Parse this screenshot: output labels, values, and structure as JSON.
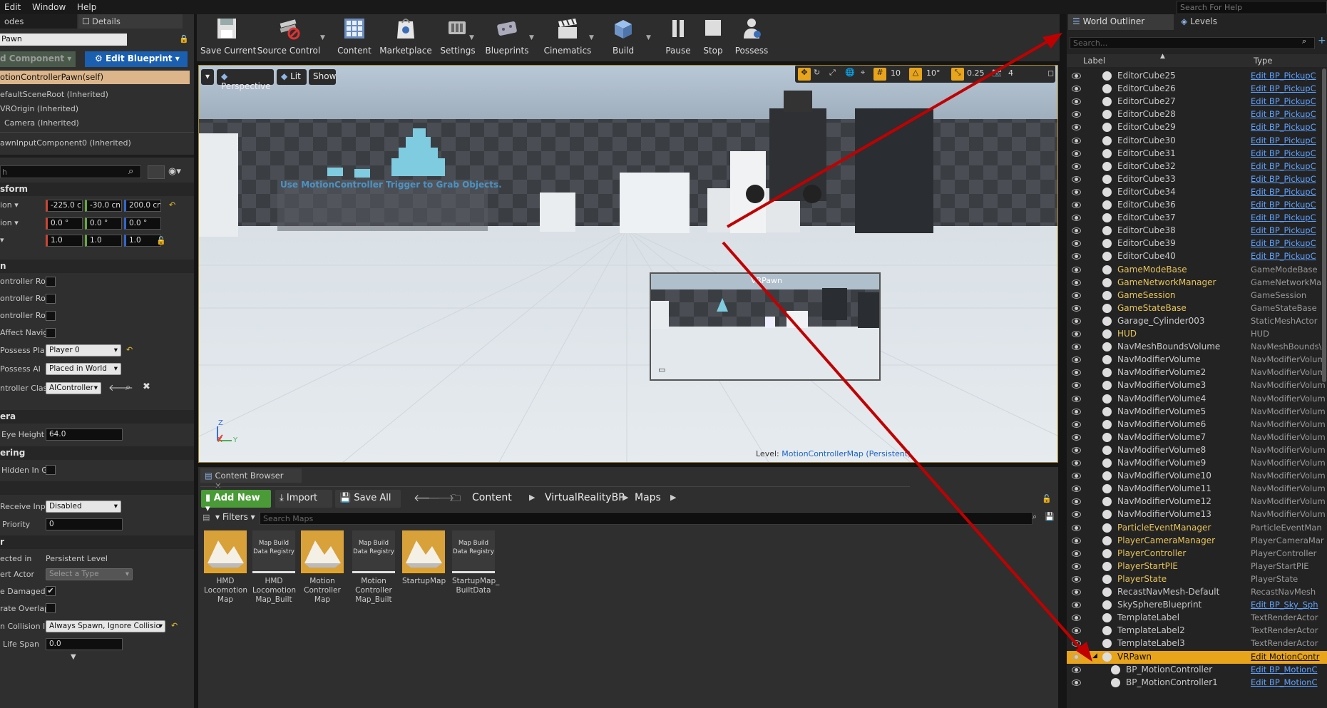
{
  "menubar": {
    "items": [
      "Edit",
      "Window",
      "Help"
    ],
    "search_placeholder": "Search For Help"
  },
  "left_panel": {
    "tabs": [
      "odes",
      "Details"
    ],
    "name_value": "Pawn",
    "add_component": "d Component",
    "edit_blueprint": "Edit Blueprint",
    "components": [
      "otionControllerPawn(self)",
      "efaultSceneRoot (Inherited)",
      "VROrigin (Inherited)",
      "Camera (Inherited)",
      "awnInputComponent0 (Inherited)"
    ],
    "search_placeholder": "h",
    "transform": {
      "title": "sform",
      "location_label": "ion",
      "location": [
        "-225.0 c",
        "-30.0 cn",
        "200.0 cn"
      ],
      "rotation_label": "ion",
      "rotation": [
        "0.0 °",
        "0.0 °",
        "0.0 °"
      ],
      "scale": [
        "1.0",
        "1.0",
        "1.0"
      ]
    },
    "pawn_section": "n",
    "pawn_props": [
      "ontroller Ro",
      "ontroller Ro",
      "ontroller Ro",
      "Affect Navig",
      "Possess Pla",
      "Possess AI",
      "ntroller Clas"
    ],
    "auto_possess_player": "Player 0",
    "auto_possess_ai": "Placed in World",
    "ai_controller_class": "AIController",
    "camera_section": "era",
    "eye_height_label": "Eye Height",
    "eye_height": "64.0",
    "rendering_section": "ering",
    "hidden_in_game": "Hidden In G",
    "input_section": "",
    "receive_input_label": "Receive Inp",
    "receive_input": "Disabled",
    "priority_label": "Priority",
    "priority": "0",
    "actor_section": "r",
    "selected_in_label": "ected in",
    "selected_in_value": "Persistent Level",
    "convert_actor_label": "ert Actor",
    "convert_actor_value": "Select a Type",
    "can_be_damaged_label": "e Damaged",
    "generate_overlap_label": "rate Overlap",
    "spawn_collision_label": "n Collision I",
    "spawn_collision_value": "Always Spawn, Ignore Collisio",
    "life_span_label": "Life Span",
    "life_span_value": "0.0"
  },
  "toolbar": {
    "buttons": [
      "Save Current",
      "Source Control",
      "Content",
      "Marketplace",
      "Settings",
      "Blueprints",
      "Cinematics",
      "Build",
      "Pause",
      "Stop",
      "Possess"
    ]
  },
  "viewport": {
    "perspective": "Perspective",
    "lit": "Lit",
    "show": "Show",
    "grid_snap": "10",
    "rot_snap": "10°",
    "scale_snap": "0.25",
    "cam_speed": "4",
    "scene_text": "Use MotionController Trigger to Grab Objects.",
    "pip_title": "VRPawn",
    "level_label": "Level:",
    "level_name": "MotionControllerMap (Persistent)",
    "axis_z": "Z",
    "axis_x": "X",
    "axis_y": "Y"
  },
  "content_browser": {
    "tab": "Content Browser",
    "add_new": "Add New",
    "import": "Import",
    "save_all": "Save All",
    "path": [
      "Content",
      "VirtualRealityBP",
      "Maps"
    ],
    "filters": "Filters",
    "search_placeholder": "Search Maps",
    "assets": [
      {
        "name": "HMD Locomotion Map",
        "kind": "map"
      },
      {
        "name": "HMD Locomotion Map_Built",
        "kind": "registry"
      },
      {
        "name": "Motion Controller Map",
        "kind": "map"
      },
      {
        "name": "Motion Controller Map_Built",
        "kind": "registry"
      },
      {
        "name": "StartupMap",
        "kind": "map"
      },
      {
        "name": "StartupMap_ BuiltData",
        "kind": "registry"
      }
    ],
    "registry_text": "Map Build Data Registry"
  },
  "outliner": {
    "tabs": [
      "World Outliner",
      "Levels"
    ],
    "search_placeholder": "Search...",
    "col_label": "Label",
    "col_type": "Type",
    "rows": [
      {
        "label": "EditorCube25",
        "type": "Edit BP_PickupC",
        "link": true
      },
      {
        "label": "EditorCube26",
        "type": "Edit BP_PickupC",
        "link": true
      },
      {
        "label": "EditorCube27",
        "type": "Edit BP_PickupC",
        "link": true
      },
      {
        "label": "EditorCube28",
        "type": "Edit BP_PickupC",
        "link": true
      },
      {
        "label": "EditorCube29",
        "type": "Edit BP_PickupC",
        "link": true
      },
      {
        "label": "EditorCube30",
        "type": "Edit BP_PickupC",
        "link": true
      },
      {
        "label": "EditorCube31",
        "type": "Edit BP_PickupC",
        "link": true
      },
      {
        "label": "EditorCube32",
        "type": "Edit BP_PickupC",
        "link": true
      },
      {
        "label": "EditorCube33",
        "type": "Edit BP_PickupC",
        "link": true
      },
      {
        "label": "EditorCube34",
        "type": "Edit BP_PickupC",
        "link": true
      },
      {
        "label": "EditorCube36",
        "type": "Edit BP_PickupC",
        "link": true
      },
      {
        "label": "EditorCube37",
        "type": "Edit BP_PickupC",
        "link": true
      },
      {
        "label": "EditorCube38",
        "type": "Edit BP_PickupC",
        "link": true
      },
      {
        "label": "EditorCube39",
        "type": "Edit BP_PickupC",
        "link": true
      },
      {
        "label": "EditorCube40",
        "type": "Edit BP_PickupC",
        "link": true
      },
      {
        "label": "GameModeBase",
        "type": "GameModeBase",
        "yellow": true
      },
      {
        "label": "GameNetworkManager",
        "type": "GameNetworkMar",
        "yellow": true
      },
      {
        "label": "GameSession",
        "type": "GameSession",
        "yellow": true
      },
      {
        "label": "GameStateBase",
        "type": "GameStateBase",
        "yellow": true
      },
      {
        "label": "Garage_Cylinder003",
        "type": "StaticMeshActor"
      },
      {
        "label": "HUD",
        "type": "HUD",
        "yellow": true
      },
      {
        "label": "NavMeshBoundsVolume",
        "type": "NavMeshBounds\\"
      },
      {
        "label": "NavModifierVolume",
        "type": "NavModifierVolum"
      },
      {
        "label": "NavModifierVolume2",
        "type": "NavModifierVolum"
      },
      {
        "label": "NavModifierVolume3",
        "type": "NavModifierVolum"
      },
      {
        "label": "NavModifierVolume4",
        "type": "NavModifierVolum"
      },
      {
        "label": "NavModifierVolume5",
        "type": "NavModifierVolum"
      },
      {
        "label": "NavModifierVolume6",
        "type": "NavModifierVolum"
      },
      {
        "label": "NavModifierVolume7",
        "type": "NavModifierVolum"
      },
      {
        "label": "NavModifierVolume8",
        "type": "NavModifierVolum"
      },
      {
        "label": "NavModifierVolume9",
        "type": "NavModifierVolum"
      },
      {
        "label": "NavModifierVolume10",
        "type": "NavModifierVolum"
      },
      {
        "label": "NavModifierVolume11",
        "type": "NavModifierVolum"
      },
      {
        "label": "NavModifierVolume12",
        "type": "NavModifierVolum"
      },
      {
        "label": "NavModifierVolume13",
        "type": "NavModifierVolum"
      },
      {
        "label": "ParticleEventManager",
        "type": "ParticleEventMan",
        "yellow": true
      },
      {
        "label": "PlayerCameraManager",
        "type": "PlayerCameraMar",
        "yellow": true
      },
      {
        "label": "PlayerController",
        "type": "PlayerController",
        "yellow": true
      },
      {
        "label": "PlayerStartPIE",
        "type": "PlayerStartPIE",
        "yellow": true
      },
      {
        "label": "PlayerState",
        "type": "PlayerState",
        "yellow": true
      },
      {
        "label": "RecastNavMesh-Default",
        "type": "RecastNavMesh"
      },
      {
        "label": "SkySphereBlueprint",
        "type": "Edit BP_Sky_Sph",
        "link": true
      },
      {
        "label": "TemplateLabel",
        "type": "TextRenderActor"
      },
      {
        "label": "TemplateLabel2",
        "type": "TextRenderActor"
      },
      {
        "label": "TemplateLabel3",
        "type": "TextRenderActor"
      },
      {
        "label": "VRPawn",
        "type": "Edit MotionContr",
        "selected": true
      },
      {
        "label": "BP_MotionController",
        "type": "Edit BP_MotionC",
        "link": true,
        "child": true
      },
      {
        "label": "BP_MotionController1",
        "type": "Edit BP_MotionC",
        "link": true,
        "child": true
      }
    ]
  },
  "colors": {
    "accent": "#e8a41a",
    "selection": "#e8a41a",
    "link": "#5fa2ff",
    "arrow": "#c00000"
  }
}
